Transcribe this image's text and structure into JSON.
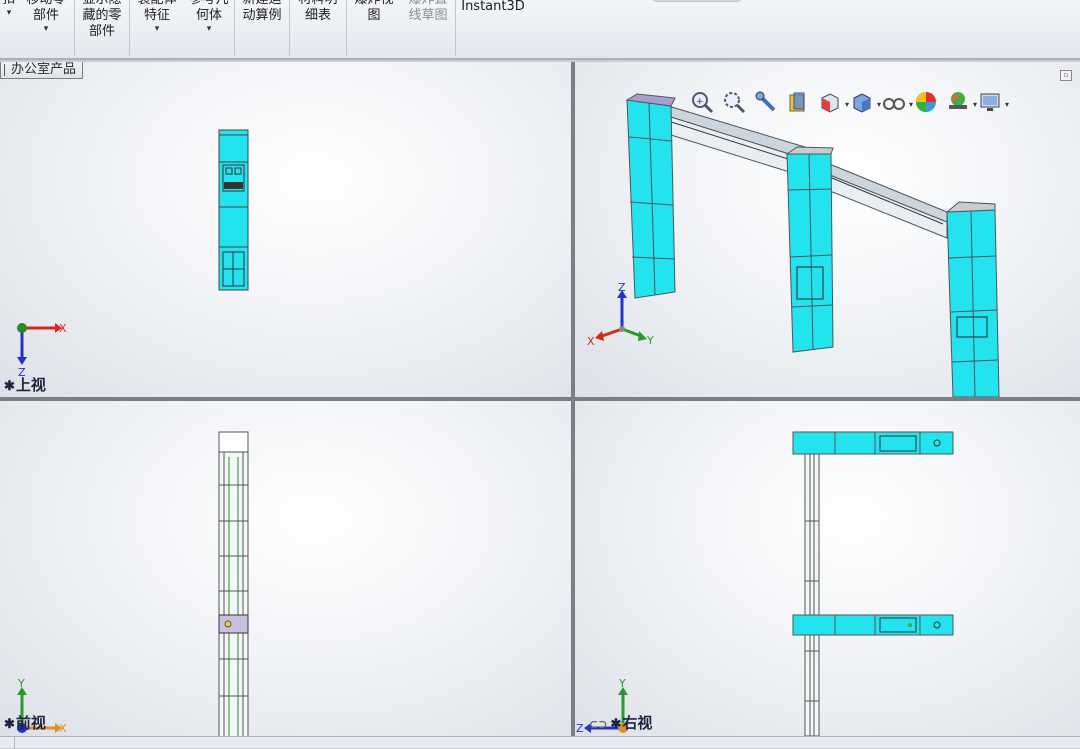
{
  "toolbar": {
    "buttons": [
      {
        "label": "扣",
        "disabled": false,
        "dropdown": true
      },
      {
        "label": "移动零\n部件",
        "disabled": false,
        "dropdown": true
      },
      {
        "label": "显示隐\n藏的零\n部件",
        "disabled": false,
        "dropdown": false
      },
      {
        "label": "装配体\n特征",
        "disabled": false,
        "dropdown": true
      },
      {
        "label": "参考几\n何体",
        "disabled": false,
        "dropdown": true
      },
      {
        "label": "新建运\n动算例",
        "disabled": false,
        "dropdown": false
      },
      {
        "label": "材料明\n细表",
        "disabled": false,
        "dropdown": false
      },
      {
        "label": "爆炸视\n图",
        "disabled": false,
        "dropdown": false
      },
      {
        "label": "爆炸直\n线草图",
        "disabled": true,
        "dropdown": false
      },
      {
        "label": "Instant3D",
        "disabled": false,
        "dropdown": false
      }
    ]
  },
  "feature_tree": {
    "tab_label": "办公室产品"
  },
  "views": {
    "top": {
      "label": "上视",
      "triad": [
        "X",
        "Z"
      ]
    },
    "iso": {
      "triad": [
        "Z",
        "X",
        "Y"
      ]
    },
    "front": {
      "label": "前视",
      "triad": [
        "Y",
        "X"
      ]
    },
    "right": {
      "label": "右视",
      "triad": [
        "Y",
        "Z"
      ]
    }
  },
  "heads_up_toolbar": [
    "zoom-to-fit-icon",
    "zoom-to-area-icon",
    "previous-view-icon",
    "section-view-icon",
    "view-orientation-icon",
    "display-style-icon",
    "hide-show-items-icon",
    "edit-appearance-icon",
    "apply-scene-icon",
    "view-settings-icon"
  ],
  "colors": {
    "cyan_panel": "#22e3ee",
    "frame": "#606870",
    "axis_x": "#d42a1c",
    "axis_y": "#2a9a2a",
    "axis_z": "#2432c8",
    "label_text": "#1b2440"
  }
}
